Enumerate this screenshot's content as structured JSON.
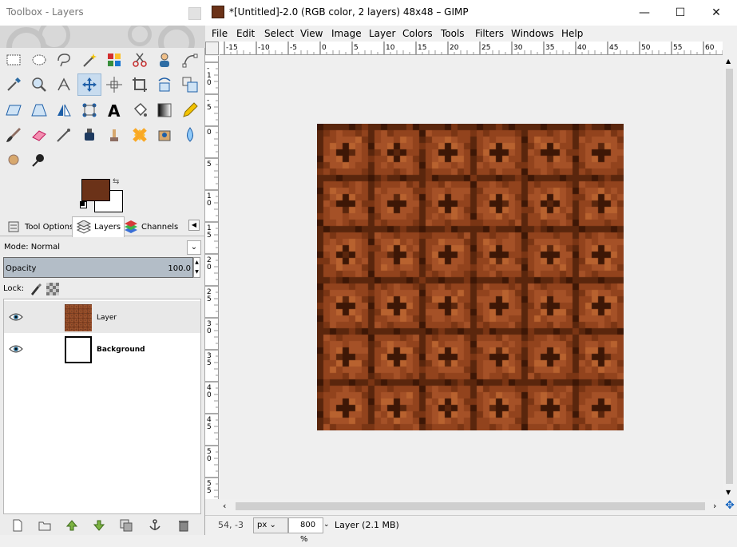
{
  "toolbox": {
    "title": "Toolbox - Layers",
    "tabs": [
      {
        "label": "Tool Options"
      },
      {
        "label": "Layers"
      },
      {
        "label": "Channels"
      }
    ],
    "mode_label": "Mode: Normal",
    "opacity_label": "Opacity",
    "opacity_value": "100.0",
    "lock_label": "Lock:",
    "layers": [
      {
        "name": "Layer",
        "visible": true,
        "selected": true
      },
      {
        "name": "Background",
        "visible": true,
        "selected": false
      }
    ],
    "fg_color": "#6b3218",
    "bg_color": "#ffffff",
    "tools": [
      "rect-select-icon",
      "ellipse-select-icon",
      "lasso-icon",
      "fuzzy-select-icon",
      "select-by-color-icon",
      "scissors-icon",
      "foreground-select-icon",
      "paths-icon",
      "color-picker-icon",
      "zoom-icon",
      "measure-icon",
      "move-icon",
      "align-icon",
      "crop-icon",
      "rotate-icon",
      "scale-icon",
      "shear-icon",
      "perspective-icon",
      "flip-icon",
      "cage-icon",
      "text-icon",
      "bucket-fill-icon",
      "blend-icon",
      "pencil-icon",
      "paintbrush-icon",
      "eraser-icon",
      "airbrush-icon",
      "ink-icon",
      "clone-icon",
      "heal-icon",
      "perspective-clone-icon",
      "blur-icon",
      "smudge-icon",
      "dodge-burn-icon"
    ]
  },
  "window": {
    "title": "*[Untitled]-2.0 (RGB color, 2 layers) 48x48 – GIMP",
    "menu": [
      "File",
      "Edit",
      "Select",
      "View",
      "Image",
      "Layer",
      "Colors",
      "Tools",
      "Filters",
      "Windows",
      "Help"
    ],
    "hruler_labels": [
      "-15",
      "-10",
      "-5",
      "0",
      "5",
      "10",
      "15",
      "20",
      "25",
      "30",
      "35",
      "40",
      "45",
      "50",
      "55",
      "60"
    ],
    "vruler_labels": [
      "-10",
      "-5",
      "0",
      "5",
      "10",
      "15",
      "20",
      "25",
      "30",
      "35",
      "40",
      "45",
      "50",
      "55"
    ],
    "status": {
      "coords": "54, -3",
      "unit": "px",
      "zoom": "800 %",
      "message": "Layer (2.1 MB)"
    }
  },
  "texture": {
    "grid": 48,
    "colors": [
      "#3d1706",
      "#5a260d",
      "#7a3514",
      "#92431d",
      "#a55127",
      "#b8622f"
    ]
  }
}
